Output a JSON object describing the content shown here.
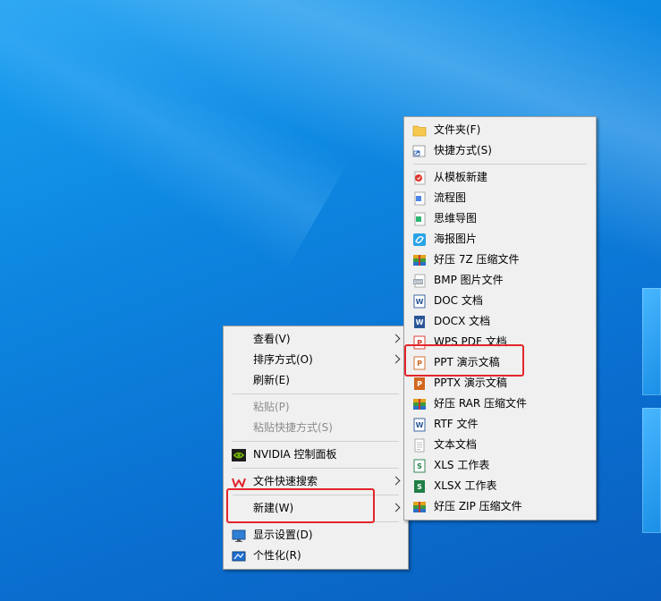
{
  "context_menu": {
    "items": [
      {
        "label": "查看(V)"
      },
      {
        "label": "排序方式(O)"
      },
      {
        "label": "刷新(E)"
      },
      {
        "label": "粘贴(P)"
      },
      {
        "label": "粘贴快捷方式(S)"
      },
      {
        "label": "NVIDIA 控制面板"
      },
      {
        "label": "文件快速搜索"
      },
      {
        "label": "新建(W)"
      },
      {
        "label": "显示设置(D)"
      },
      {
        "label": "个性化(R)"
      }
    ]
  },
  "new_submenu": {
    "items": [
      {
        "label": "文件夹(F)"
      },
      {
        "label": "快捷方式(S)"
      },
      {
        "label": "从模板新建"
      },
      {
        "label": "流程图"
      },
      {
        "label": "思维导图"
      },
      {
        "label": "海报图片"
      },
      {
        "label": "好压 7Z 压缩文件"
      },
      {
        "label": "BMP 图片文件"
      },
      {
        "label": "DOC 文档"
      },
      {
        "label": "DOCX 文档"
      },
      {
        "label": "WPS PDF 文档"
      },
      {
        "label": "PPT 演示文稿"
      },
      {
        "label": "PPTX 演示文稿"
      },
      {
        "label": "好压 RAR 压缩文件"
      },
      {
        "label": "RTF 文件"
      },
      {
        "label": "文本文档"
      },
      {
        "label": "XLS 工作表"
      },
      {
        "label": "XLSX 工作表"
      },
      {
        "label": "好压 ZIP 压缩文件"
      }
    ]
  },
  "colors": {
    "highlight_box": "#e3262b",
    "menu_bg": "#f0f0f0",
    "disabled_text": "#8c8c8c"
  }
}
